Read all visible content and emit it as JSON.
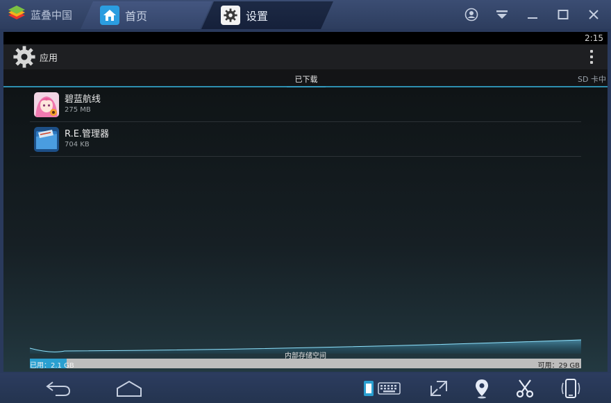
{
  "titlebar": {
    "brand": "蓝叠中国",
    "tabs": [
      {
        "label": "首页",
        "icon": "home-icon"
      },
      {
        "label": "设置",
        "icon": "gear-icon"
      }
    ],
    "controls": [
      "account-icon",
      "dropdown-menu-icon",
      "minimize-icon",
      "maximize-icon",
      "close-icon"
    ]
  },
  "statusbar": {
    "time": "2:15"
  },
  "actionbar": {
    "title": "应用"
  },
  "subtabs": {
    "downloaded": "已下载",
    "sd_card": "SD 卡中"
  },
  "apps": [
    {
      "name": "碧蓝航线",
      "size": "275 MB"
    },
    {
      "name": "R.E.管理器",
      "size": "704 KB"
    }
  ],
  "storage": {
    "label": "内部存储空间",
    "used": "已用：2.1 GB",
    "free": "可用：29 GB",
    "used_fraction": 0.067
  },
  "bottombar": [
    "back-icon",
    "home-outline-icon",
    "keyboard-toggle-icon",
    "fullscreen-icon",
    "location-icon",
    "screenshot-scissors-icon",
    "rotate-phone-icon"
  ],
  "colors": {
    "accent": "#2a9fd0",
    "titlebar": "#34456a"
  }
}
